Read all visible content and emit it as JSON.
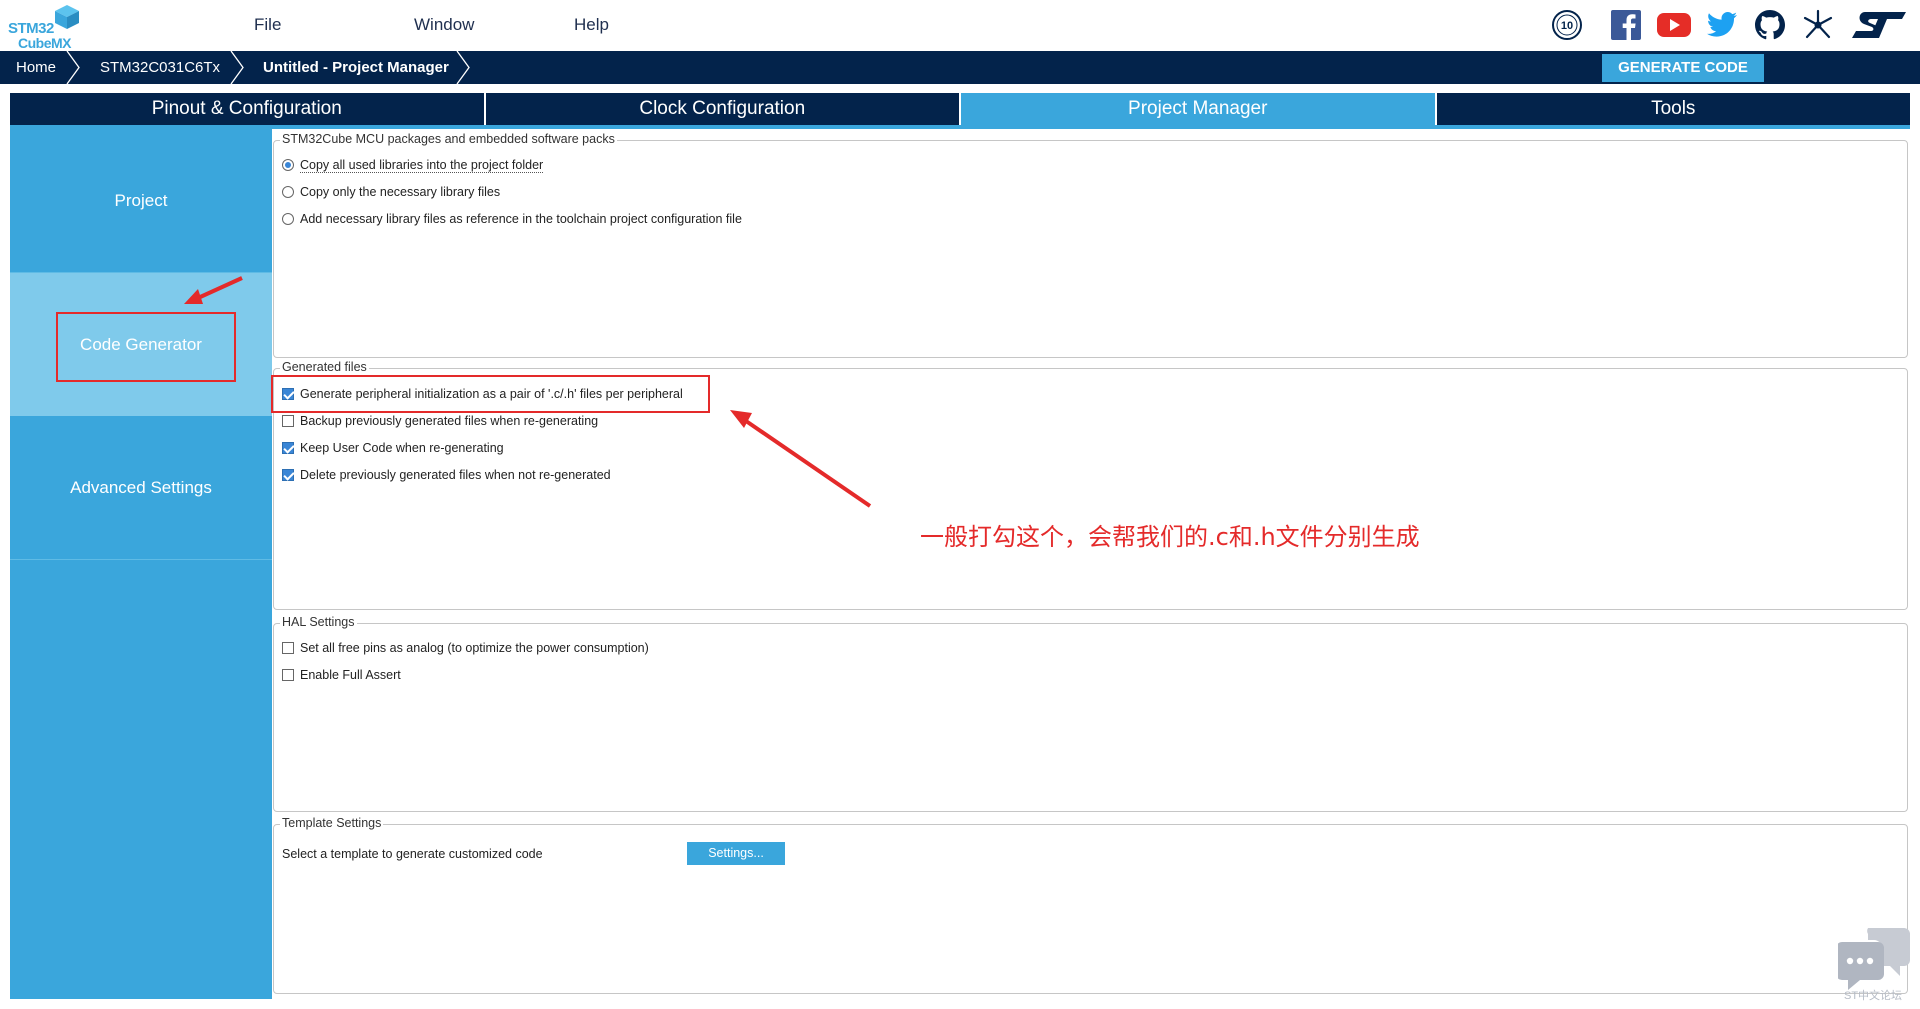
{
  "app": {
    "logo_line1": "STM32",
    "logo_line2": "CubeMX",
    "menu": [
      "File",
      "Window",
      "Help"
    ],
    "badge_text": "10"
  },
  "breadcrumb": {
    "items": [
      "Home",
      "STM32C031C6Tx",
      "Untitled - Project Manager"
    ],
    "generate_label": "GENERATE CODE"
  },
  "tabs": [
    {
      "label": "Pinout & Configuration",
      "active": false
    },
    {
      "label": "Clock Configuration",
      "active": false
    },
    {
      "label": "Project Manager",
      "active": true
    },
    {
      "label": "Tools",
      "active": false
    }
  ],
  "sidebar": {
    "items": [
      {
        "label": "Project",
        "active": false
      },
      {
        "label": "Code Generator",
        "active": true
      },
      {
        "label": "Advanced Settings",
        "active": false
      }
    ]
  },
  "groups": {
    "packages": {
      "title": "STM32Cube MCU packages and embedded software packs",
      "options": [
        {
          "label": "Copy all used libraries into the project folder",
          "selected": true
        },
        {
          "label": "Copy only the necessary library files",
          "selected": false
        },
        {
          "label": "Add necessary library files as reference in the toolchain project configuration file",
          "selected": false
        }
      ]
    },
    "generated": {
      "title": "Generated files",
      "options": [
        {
          "label": "Generate peripheral initialization as a pair of '.c/.h' files per peripheral",
          "checked": true
        },
        {
          "label": "Backup previously generated files when re-generating",
          "checked": false
        },
        {
          "label": "Keep User Code when re-generating",
          "checked": true
        },
        {
          "label": "Delete previously generated files when not re-generated",
          "checked": true
        }
      ]
    },
    "hal": {
      "title": "HAL Settings",
      "options": [
        {
          "label": "Set all free pins as analog (to optimize the power consumption)",
          "checked": false
        },
        {
          "label": "Enable Full Assert",
          "checked": false
        }
      ]
    },
    "template": {
      "title": "Template Settings",
      "label": "Select a template to generate customized code",
      "button": "Settings..."
    }
  },
  "annotation": {
    "text": "一般打勾这个，会帮我们的.c和.h文件分别生成"
  },
  "watermark": {
    "text": "ST中文论坛"
  },
  "colors": {
    "navy": "#03234b",
    "accent": "#3aa6dc",
    "active_nav": "#7fcaeb",
    "annotation_red": "#e42a2a"
  },
  "icons": [
    "anniversary-badge-icon",
    "facebook-icon",
    "youtube-icon",
    "twitter-icon",
    "github-icon",
    "network-icon",
    "st-logo-icon"
  ]
}
